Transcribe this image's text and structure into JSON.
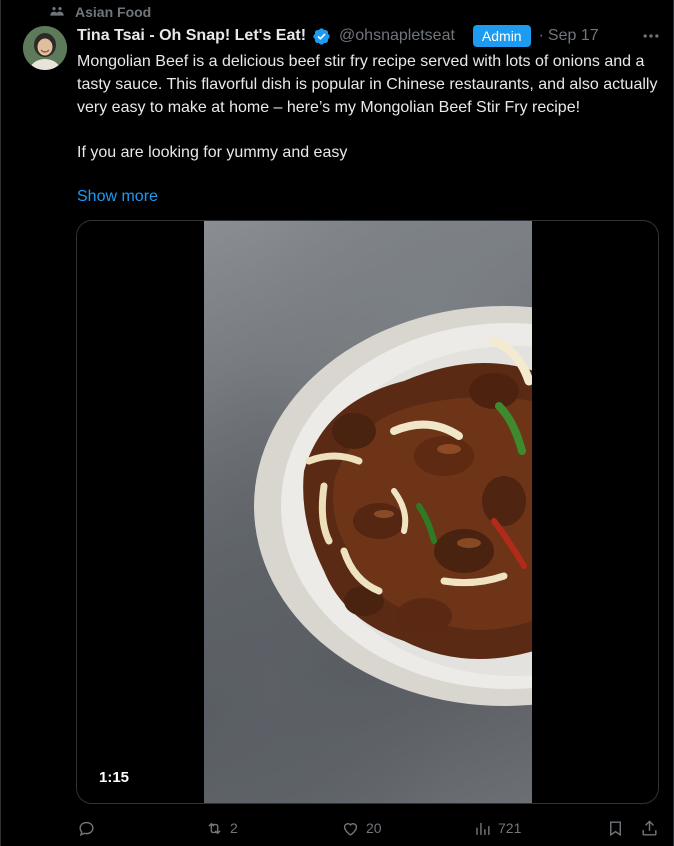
{
  "context": {
    "community_label": "Asian Food",
    "icon": "community-icon"
  },
  "author": {
    "display_name": "Tina Tsai - Oh Snap! Let's Eat!",
    "handle": "@ohsnapletseat",
    "verified": true,
    "badge": "Admin",
    "separator": "·",
    "date": "Sep 17",
    "avatar_icon": "avatar-photo"
  },
  "post": {
    "paragraph_1": "Mongolian Beef is a delicious beef stir fry recipe served with lots of onions and a tasty sauce. This flavorful dish is popular in Chinese restaurants, and also actually very easy to make at home – here’s my Mongolian Beef Stir Fry recipe!",
    "paragraph_2": "If you are looking for yummy and easy",
    "show_more_label": "Show more"
  },
  "media": {
    "type": "video",
    "duration": "1:15"
  },
  "actions": {
    "reply_count": "",
    "repost_count": "2",
    "like_count": "20",
    "view_count": "721"
  },
  "colors": {
    "background": "#000000",
    "text": "#e7e9ea",
    "muted": "#71767b",
    "accent": "#1d9bf0",
    "border": "#2f3336"
  }
}
